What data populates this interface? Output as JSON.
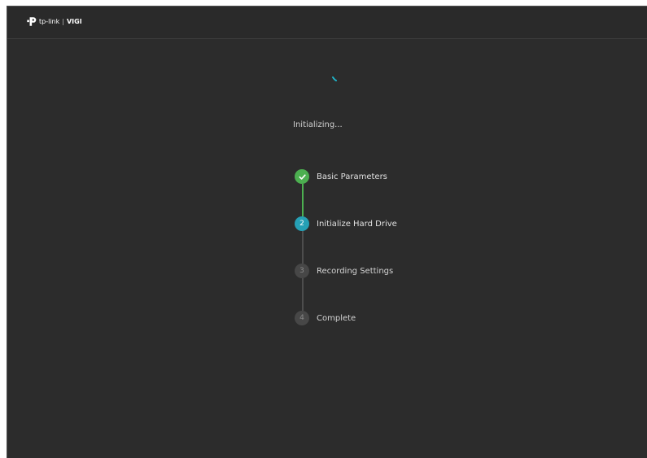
{
  "header": {
    "brand": "tp-link",
    "separator": "|",
    "product": "VIGI"
  },
  "status": {
    "text": "Initializing..."
  },
  "steps": [
    {
      "number": "1",
      "label": "Basic Parameters",
      "state": "complete",
      "icon": "check-icon"
    },
    {
      "number": "2",
      "label": "Initialize Hard Drive",
      "state": "active"
    },
    {
      "number": "3",
      "label": "Recording Settings",
      "state": "pending"
    },
    {
      "number": "4",
      "label": "Complete",
      "state": "pending"
    }
  ],
  "colors": {
    "background": "#2c2c2c",
    "complete": "#4caf50",
    "active": "#26a0b5",
    "pending": "#4a4a4a",
    "complete_line": "#4caf50",
    "pending_line": "#4d4d4d",
    "accent": "#1fb5c9"
  }
}
